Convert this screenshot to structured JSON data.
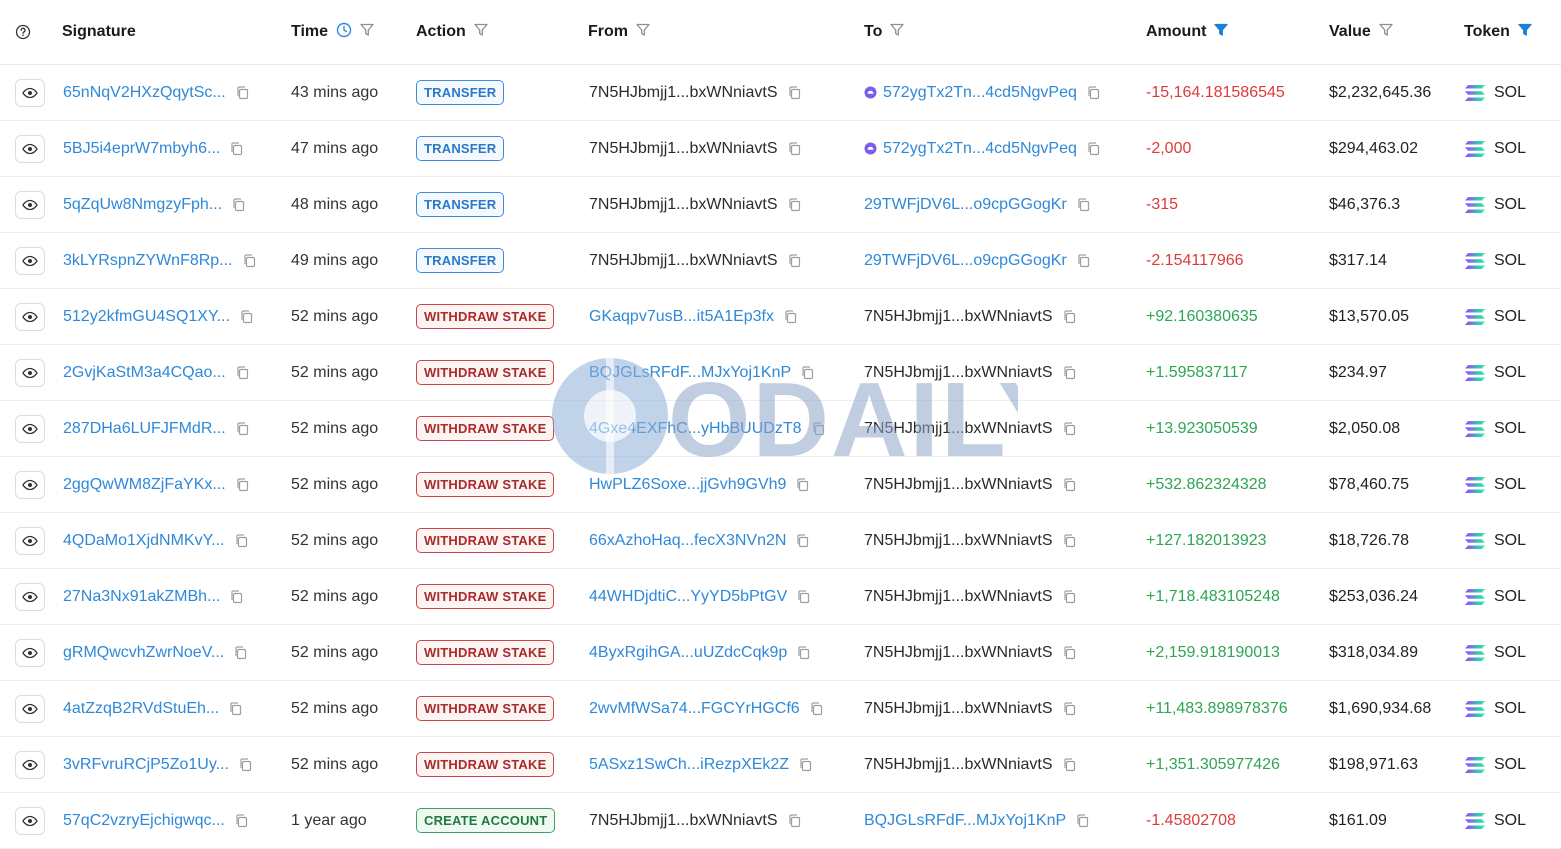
{
  "header": {
    "help_icon": "question-circle-icon",
    "signature": "Signature",
    "time": "Time",
    "action": "Action",
    "from": "From",
    "to": "To",
    "amount": "Amount",
    "value": "Value",
    "token": "Token"
  },
  "colors": {
    "link": "#2f88d8",
    "negative": "#dc3b3b",
    "positive": "#2ea553",
    "filter_active": "#1e7fd8",
    "filter_inactive": "#8a8f96"
  },
  "watermark_text": "ODAILY",
  "rows": [
    {
      "signature": "65nNqV2HXzQqytSc...",
      "time": "43 mins ago",
      "action": "TRANSFER",
      "action_type": "transfer",
      "from": "7N5HJbmjj1...bxWNniavtS",
      "from_link": false,
      "to": "572ygTx2Tn...4cd5NgvPeq",
      "to_link": true,
      "to_icon": true,
      "amount": "-15,164.181586545",
      "amount_sign": "neg",
      "value": "$2,232,645.36",
      "token": "SOL"
    },
    {
      "signature": "5BJ5i4eprW7mbyh6...",
      "time": "47 mins ago",
      "action": "TRANSFER",
      "action_type": "transfer",
      "from": "7N5HJbmjj1...bxWNniavtS",
      "from_link": false,
      "to": "572ygTx2Tn...4cd5NgvPeq",
      "to_link": true,
      "to_icon": true,
      "amount": "-2,000",
      "amount_sign": "neg",
      "value": "$294,463.02",
      "token": "SOL"
    },
    {
      "signature": "5qZqUw8NmgzyFph...",
      "time": "48 mins ago",
      "action": "TRANSFER",
      "action_type": "transfer",
      "from": "7N5HJbmjj1...bxWNniavtS",
      "from_link": false,
      "to": "29TWFjDV6L...o9cpGGogKr",
      "to_link": true,
      "to_icon": false,
      "amount": "-315",
      "amount_sign": "neg",
      "value": "$46,376.3",
      "token": "SOL"
    },
    {
      "signature": "3kLYRspnZYWnF8Rp...",
      "time": "49 mins ago",
      "action": "TRANSFER",
      "action_type": "transfer",
      "from": "7N5HJbmjj1...bxWNniavtS",
      "from_link": false,
      "to": "29TWFjDV6L...o9cpGGogKr",
      "to_link": true,
      "to_icon": false,
      "amount": "-2.154117966",
      "amount_sign": "neg",
      "value": "$317.14",
      "token": "SOL"
    },
    {
      "signature": "512y2kfmGU4SQ1XY...",
      "time": "52 mins ago",
      "action": "WITHDRAW STAKE",
      "action_type": "withdraw",
      "from": "GKaqpv7usB...it5A1Ep3fx",
      "from_link": true,
      "to": "7N5HJbmjj1...bxWNniavtS",
      "to_link": false,
      "to_icon": false,
      "amount": "+92.160380635",
      "amount_sign": "pos",
      "value": "$13,570.05",
      "token": "SOL"
    },
    {
      "signature": "2GvjKaStM3a4CQao...",
      "time": "52 mins ago",
      "action": "WITHDRAW STAKE",
      "action_type": "withdraw",
      "from": "BQJGLsRFdF...MJxYoj1KnP",
      "from_link": true,
      "to": "7N5HJbmjj1...bxWNniavtS",
      "to_link": false,
      "to_icon": false,
      "amount": "+1.595837117",
      "amount_sign": "pos",
      "value": "$234.97",
      "token": "SOL"
    },
    {
      "signature": "287DHa6LUFJFMdR...",
      "time": "52 mins ago",
      "action": "WITHDRAW STAKE",
      "action_type": "withdraw",
      "from": "4Gxe4EXFhC...yHbBUUDzT8",
      "from_link": true,
      "to": "7N5HJbmjj1...bxWNniavtS",
      "to_link": false,
      "to_icon": false,
      "amount": "+13.923050539",
      "amount_sign": "pos",
      "value": "$2,050.08",
      "token": "SOL"
    },
    {
      "signature": "2ggQwWM8ZjFaYKx...",
      "time": "52 mins ago",
      "action": "WITHDRAW STAKE",
      "action_type": "withdraw",
      "from": "HwPLZ6Soxe...jjGvh9GVh9",
      "from_link": true,
      "to": "7N5HJbmjj1...bxWNniavtS",
      "to_link": false,
      "to_icon": false,
      "amount": "+532.862324328",
      "amount_sign": "pos",
      "value": "$78,460.75",
      "token": "SOL"
    },
    {
      "signature": "4QDaMo1XjdNMKvY...",
      "time": "52 mins ago",
      "action": "WITHDRAW STAKE",
      "action_type": "withdraw",
      "from": "66xAzhoHaq...fecX3NVn2N",
      "from_link": true,
      "to": "7N5HJbmjj1...bxWNniavtS",
      "to_link": false,
      "to_icon": false,
      "amount": "+127.182013923",
      "amount_sign": "pos",
      "value": "$18,726.78",
      "token": "SOL"
    },
    {
      "signature": "27Na3Nx91akZMBh...",
      "time": "52 mins ago",
      "action": "WITHDRAW STAKE",
      "action_type": "withdraw",
      "from": "44WHDjdtiC...YyYD5bPtGV",
      "from_link": true,
      "to": "7N5HJbmjj1...bxWNniavtS",
      "to_link": false,
      "to_icon": false,
      "amount": "+1,718.483105248",
      "amount_sign": "pos",
      "value": "$253,036.24",
      "token": "SOL"
    },
    {
      "signature": "gRMQwcvhZwrNoeV...",
      "time": "52 mins ago",
      "action": "WITHDRAW STAKE",
      "action_type": "withdraw",
      "from": "4ByxRgihGA...uUZdcCqk9p",
      "from_link": true,
      "to": "7N5HJbmjj1...bxWNniavtS",
      "to_link": false,
      "to_icon": false,
      "amount": "+2,159.918190013",
      "amount_sign": "pos",
      "value": "$318,034.89",
      "token": "SOL"
    },
    {
      "signature": "4atZzqB2RVdStuEh...",
      "time": "52 mins ago",
      "action": "WITHDRAW STAKE",
      "action_type": "withdraw",
      "from": "2wvMfWSa74...FGCYrHGCf6",
      "from_link": true,
      "to": "7N5HJbmjj1...bxWNniavtS",
      "to_link": false,
      "to_icon": false,
      "amount": "+11,483.898978376",
      "amount_sign": "pos",
      "value": "$1,690,934.68",
      "token": "SOL"
    },
    {
      "signature": "3vRFvruRCjP5Zo1Uy...",
      "time": "52 mins ago",
      "action": "WITHDRAW STAKE",
      "action_type": "withdraw",
      "from": "5ASxz1SwCh...iRezpXEk2Z",
      "from_link": true,
      "to": "7N5HJbmjj1...bxWNniavtS",
      "to_link": false,
      "to_icon": false,
      "amount": "+1,351.305977426",
      "amount_sign": "pos",
      "value": "$198,971.63",
      "token": "SOL"
    },
    {
      "signature": "57qC2vzryEjchigwqc...",
      "time": "1 year ago",
      "action": "CREATE ACCOUNT",
      "action_type": "create",
      "from": "7N5HJbmjj1...bxWNniavtS",
      "from_link": false,
      "to": "BQJGLsRFdF...MJxYoj1KnP",
      "to_link": true,
      "to_icon": false,
      "amount": "-1.45802708",
      "amount_sign": "neg",
      "value": "$161.09",
      "token": "SOL"
    }
  ]
}
